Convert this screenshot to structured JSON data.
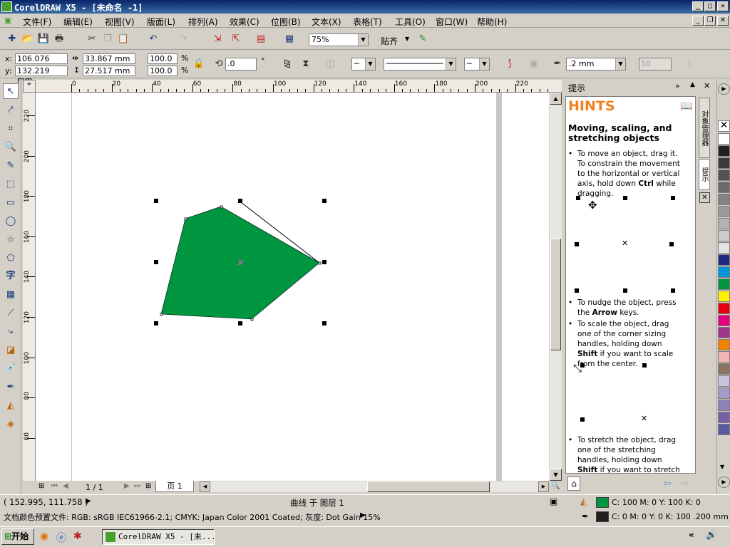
{
  "window": {
    "title": "CorelDRAW X5 - [未命名 -1]",
    "min": "_",
    "max": "▢",
    "close": "✕"
  },
  "menu": [
    "文件(F)",
    "编辑(E)",
    "视图(V)",
    "版面(L)",
    "排列(A)",
    "效果(C)",
    "位图(B)",
    "文本(X)",
    "表格(T)",
    "工具(O)",
    "窗口(W)",
    "帮助(H)"
  ],
  "toolbar": {
    "zoom": "75%",
    "snap": "贴齐"
  },
  "props": {
    "x_label": "x:",
    "x": "106.076 mm",
    "y_label": "y:",
    "y": "132.219 mm",
    "w": "33.867 mm",
    "h": "27.517 mm",
    "sx": "100.0",
    "sy": "100.0",
    "pct": "%",
    "angle": ".0",
    "deg": "°",
    "outline": ".2 mm",
    "blend": "50"
  },
  "ruler": {
    "top": [
      "0",
      "20",
      "40",
      "60",
      "80",
      "100",
      "120",
      "140",
      "160",
      "180",
      "200",
      "220"
    ],
    "left": [
      "220",
      "200",
      "180",
      "160",
      "140",
      "120",
      "100",
      "80",
      "60"
    ]
  },
  "pages": {
    "counter": "1 / 1",
    "tab": "页 1"
  },
  "docker": {
    "title": "提示",
    "hints_heading": "HINTS",
    "hint_title": "Moving, scaling, and stretching objects",
    "tips": [
      {
        "pre": "To move an object, drag it. To constrain the movement to the horizontal or vertical axis, hold down ",
        "key": "Ctrl",
        "post": " while dragging."
      },
      {
        "pre": "To nudge the object, press the ",
        "key": "Arrow",
        "post": " keys."
      },
      {
        "pre": "To scale the object, drag one of the corner sizing handles, holding down ",
        "key": "Shift",
        "post": " if you want to scale from the center."
      },
      {
        "pre": "To stretch the object, drag one of the stretching handles, holding down ",
        "key": "Shift",
        "post": " if you want to stretch from the"
      }
    ],
    "side_tabs": [
      "对象管理器",
      "提示"
    ]
  },
  "status": {
    "coords": "( 152.995, 111.758 )",
    "layer": "曲线 于 图层 1",
    "profile": "文档颜色预置文件: RGB: sRGB IEC61966-2.1; CMYK: Japan Color 2001 Coated; 灰度: Dot Gain 15%",
    "fill": "C: 100 M: 0 Y: 100 K: 0",
    "outline": "C: 0 M: 0 Y: 0 K: 100  .200 mm"
  },
  "taskbar": {
    "start": "开始",
    "app": "CorelDRAW X5 - [未..."
  },
  "colors": {
    "fill": "#00953f",
    "palette": [
      "#ffffff",
      "#231f20",
      "#3b3b3b",
      "#535353",
      "#6b6b6b",
      "#838383",
      "#9b9b9b",
      "#b3b3b3",
      "#cbcbcb",
      "#e3e3e3",
      "#1e2a80",
      "#0095d9",
      "#00953f",
      "#fff000",
      "#e60012",
      "#e4007f",
      "#a0338d",
      "#f08300",
      "#f5b2b2",
      "#8c7463",
      "#c9c3df",
      "#a59aca",
      "#8f82bc",
      "#7460a3",
      "#5a5aa0"
    ]
  }
}
